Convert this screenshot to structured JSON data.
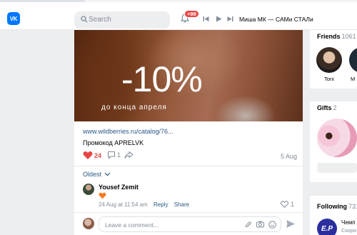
{
  "app": {
    "logo_text": "VK",
    "brand_color": "#0077ff"
  },
  "header": {
    "search_placeholder": "Search",
    "notifications_badge": "+99",
    "player": {
      "track": "Миша МК — САМи СТАЛи"
    }
  },
  "post": {
    "banner": {
      "headline": "-10%",
      "subtitle": "до конца апреля"
    },
    "link": "www.wildberries.ru/catalog/76...",
    "text": "Промокод APRELVK",
    "likes": "24",
    "comments": "1",
    "date": "5 Aug",
    "sort_label": "Oldest",
    "comment": {
      "author": "Yousef Zemit",
      "meta": "24 Aug at 11:54 am",
      "reply_label": "Reply",
      "share_label": "Share",
      "likes": "1"
    },
    "comment_input_placeholder": "Leave a comment..."
  },
  "sidebar": {
    "friends": {
      "title": "Friends",
      "count": "1061",
      "items": [
        {
          "name": "Toni"
        },
        {
          "name": "M"
        }
      ]
    },
    "gifts": {
      "title": "Gifts",
      "count": "2"
    },
    "following": {
      "title": "Following",
      "count": "731",
      "item_name": "Чемп",
      "item_sub": "Скоро",
      "item_logo": "E.P"
    }
  }
}
